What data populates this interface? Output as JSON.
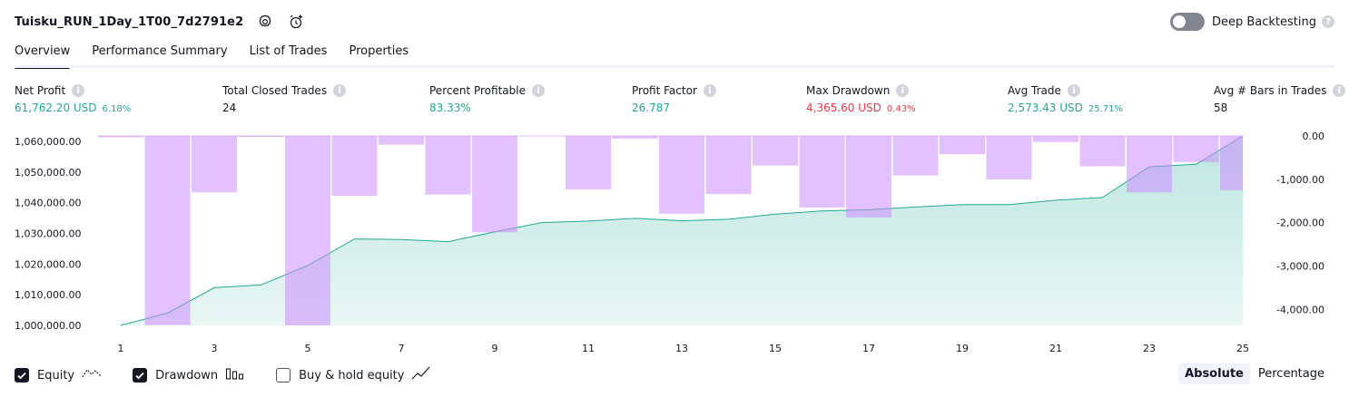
{
  "header": {
    "title": "Tuisku_RUN_1Day_1T00_7d2791e2",
    "settings_icon": "gear-icon",
    "alert_icon": "alarm-plus-icon"
  },
  "deep_backtesting": {
    "label": "Deep Backtesting",
    "enabled": false,
    "help_icon": "question-icon"
  },
  "tabs": [
    {
      "label": "Overview",
      "active": true
    },
    {
      "label": "Performance Summary",
      "active": false
    },
    {
      "label": "List of Trades",
      "active": false
    },
    {
      "label": "Properties",
      "active": false
    }
  ],
  "stats": [
    {
      "label": "Net Profit",
      "value": "61,762.20 USD",
      "pct": "6.18%",
      "color": "green"
    },
    {
      "label": "Total Closed Trades",
      "value": "24",
      "pct": "",
      "color": "plain"
    },
    {
      "label": "Percent Profitable",
      "value": "83.33%",
      "pct": "",
      "color": "green"
    },
    {
      "label": "Profit Factor",
      "value": "26.787",
      "pct": "",
      "color": "green"
    },
    {
      "label": "Max Drawdown",
      "value": "4,365.60 USD",
      "pct": "0.43%",
      "color": "red"
    },
    {
      "label": "Avg Trade",
      "value": "2,573.43 USD",
      "pct": "25.71%",
      "color": "green"
    },
    {
      "label": "Avg # Bars in Trades",
      "value": "58",
      "pct": "",
      "color": "plain"
    }
  ],
  "chart_data": {
    "type": "area",
    "x": [
      1,
      2,
      3,
      4,
      5,
      6,
      7,
      8,
      9,
      10,
      11,
      12,
      13,
      14,
      15,
      16,
      17,
      18,
      19,
      20,
      21,
      22,
      23,
      24,
      25
    ],
    "x_ticks": [
      "1",
      "3",
      "5",
      "7",
      "9",
      "11",
      "13",
      "15",
      "17",
      "19",
      "21",
      "23",
      "25"
    ],
    "left_axis": {
      "ticks": [
        "1,000,000.00",
        "1,010,000.00",
        "1,020,000.00",
        "1,030,000.00",
        "1,040,000.00",
        "1,050,000.00",
        "1,060,000.00"
      ],
      "ylim": [
        1000000,
        1061762
      ]
    },
    "right_axis": {
      "ticks": [
        "0.00",
        "-1,000.00",
        "-2,000.00",
        "-3,000.00",
        "-4,000.00"
      ],
      "ylim": [
        -4365.6,
        0
      ]
    },
    "series": [
      {
        "name": "Equity",
        "axis": "left",
        "color": "#22ab94",
        "values": [
          1000000,
          1004000,
          1012300,
          1013200,
          1019500,
          1028200,
          1028000,
          1027300,
          1030500,
          1033500,
          1034000,
          1034900,
          1034100,
          1034600,
          1036300,
          1037300,
          1037700,
          1038600,
          1039400,
          1039400,
          1040800,
          1041700,
          1051700,
          1052500,
          1061762
        ]
      },
      {
        "name": "Drawdown",
        "axis": "right",
        "color": "#d9b3ff",
        "values": [
          -30,
          -4360,
          -1300,
          -20,
          -4365.6,
          -1380,
          -200,
          -1350,
          -2220,
          0,
          -1230,
          -60,
          -1790,
          -1340,
          -680,
          -1650,
          -1880,
          -910,
          -420,
          -1000,
          -140,
          -700,
          -1300,
          -600,
          -1250
        ]
      }
    ]
  },
  "legend": [
    {
      "label": "Equity",
      "checked": true,
      "icon": "equity-line-icon"
    },
    {
      "label": "Drawdown",
      "checked": true,
      "icon": "drawdown-bars-icon"
    },
    {
      "label": "Buy & hold equity",
      "checked": false,
      "icon": "buy-hold-line-icon"
    }
  ],
  "view_modes": [
    {
      "label": "Absolute",
      "active": true
    },
    {
      "label": "Percentage",
      "active": false
    }
  ]
}
